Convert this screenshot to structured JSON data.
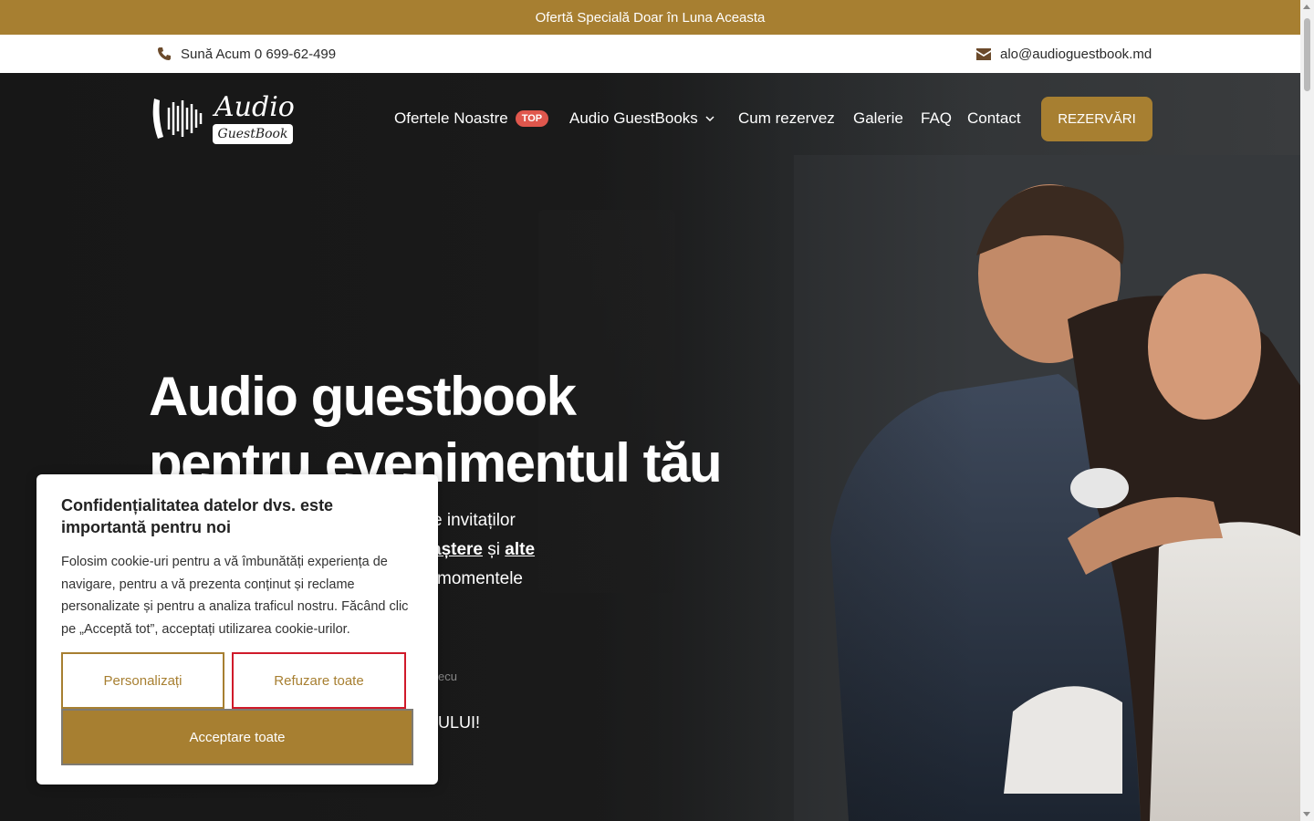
{
  "promo": {
    "text": "Ofertă Specială Doar în Luna Aceasta"
  },
  "contact": {
    "phone": "Sună Acum 0 699-62-499",
    "email": "alo@audioguestbook.md"
  },
  "logo": {
    "line1": "Audio",
    "line2": "GuestBook"
  },
  "nav": {
    "items": [
      {
        "label": "Ofertele Noastre",
        "badge": "TOP"
      },
      {
        "label": "Audio GuestBooks"
      },
      {
        "label": "Cum rezervez"
      },
      {
        "label": "Galerie"
      },
      {
        "label": "FAQ"
      },
      {
        "label": "Contact"
      }
    ],
    "cta": "REZERVĂRI"
  },
  "hero": {
    "title_line1": "Audio guestbook",
    "title_line2": "pentru evenimentul tău",
    "text_line1": "iele invitaților",
    "text_line2_link1": "aștere",
    "text_line2_mid": " și ",
    "text_line2_link2": "alte",
    "text_line3": "momentele",
    "small_text": "ecu",
    "end_text": "ULUI!"
  },
  "cookie": {
    "title": "Confidențialitatea datelor dvs. este importantă pentru noi",
    "body": "Folosim cookie-uri pentru a vă îmbunătăți experiența de navigare, pentru a vă prezenta conținut și reclame personalizate și pentru a analiza traficul nostru. Făcând clic pe „Acceptă tot”, acceptați utilizarea cookie-urilor.",
    "btn_personalize": "Personalizați",
    "btn_reject": "Refuzare toate",
    "btn_accept": "Acceptare toate"
  },
  "colors": {
    "brand": "#a77f31",
    "badge": "#e0574d",
    "reject_border": "#d01a2a"
  }
}
